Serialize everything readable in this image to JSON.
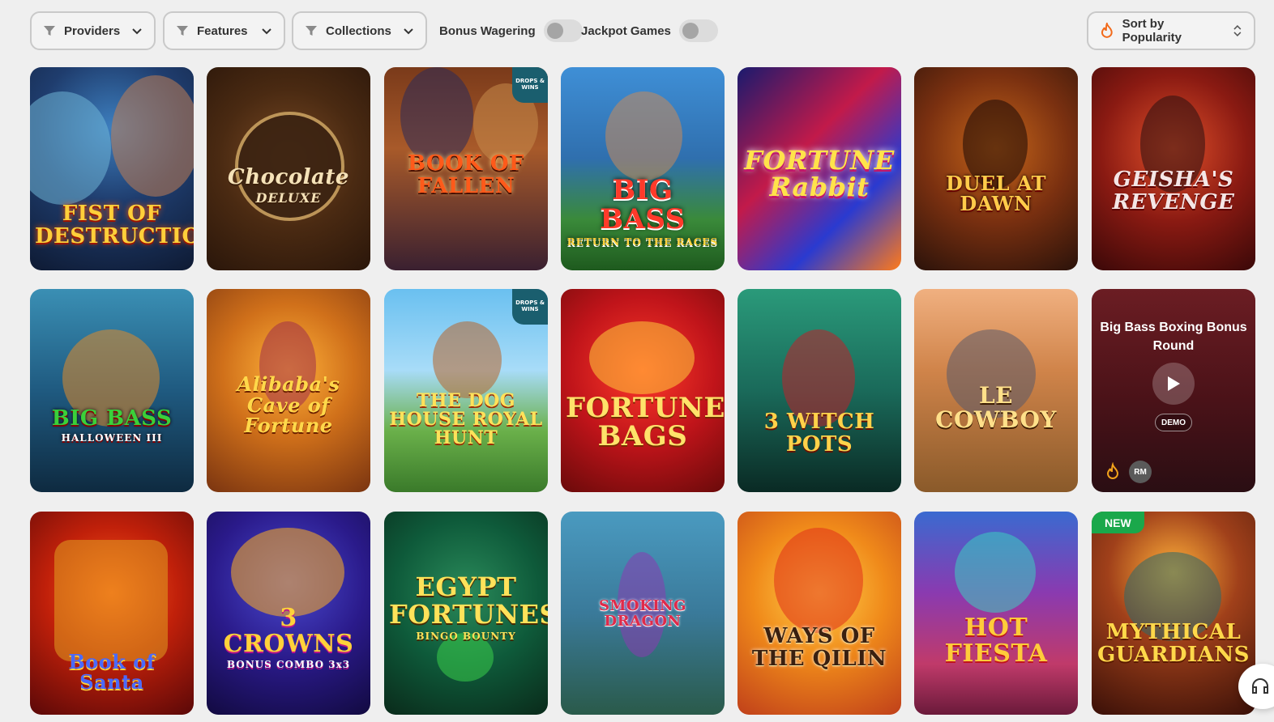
{
  "toolbar": {
    "providers_label": "Providers",
    "features_label": "Features",
    "collections_label": "Collections",
    "bonus_wagering_label": "Bonus Wagering",
    "bonus_wagering_on": false,
    "jackpot_games_label": "Jackpot Games",
    "jackpot_games_on": false,
    "sort_label": "Sort by Popularity",
    "sort_icon": "flame-icon"
  },
  "games": [
    {
      "title": "FIST OF DESTRUCTION",
      "sub": ""
    },
    {
      "title": "Chocolate",
      "sub": "DELUXE"
    },
    {
      "title": "BOOK OF FALLEN",
      "sub": "",
      "badge": "DROPS & WINS"
    },
    {
      "title": "BIG BASS",
      "sub": "RETURN TO THE RACES"
    },
    {
      "title": "FORTUNE Rabbit",
      "sub": ""
    },
    {
      "title": "DUEL AT DAWN",
      "sub": ""
    },
    {
      "title": "GEISHA'S REVENGE",
      "sub": ""
    },
    {
      "title": "BIG BASS",
      "sub": "HALLOWEEN III"
    },
    {
      "title": "Alibaba's Cave of Fortune",
      "sub": ""
    },
    {
      "title": "THE DOG HOUSE ROYAL HUNT",
      "sub": "",
      "badge": "DROPS & WINS"
    },
    {
      "title": "FORTUNE BAGS",
      "sub": ""
    },
    {
      "title": "3 WITCH POTS",
      "sub": ""
    },
    {
      "title": "LE COWBOY",
      "sub": ""
    },
    {
      "title": "Big Bass Boxing Bonus Round",
      "demo_label": "DEMO",
      "rm_label": "RM"
    },
    {
      "title": "Book of Santa",
      "sub": ""
    },
    {
      "title": "3 CROWNS",
      "sub": "BONUS COMBO 3x3"
    },
    {
      "title": "EGYPT FORTUNES",
      "sub": "BINGO BOUNTY"
    },
    {
      "title": "SMOKING DRAGON",
      "sub": ""
    },
    {
      "title": "WAYS OF THE QILIN",
      "sub": ""
    },
    {
      "title": "HOT FIESTA",
      "sub": ""
    },
    {
      "title": "MYTHICAL GUARDIANS",
      "sub": "",
      "new_label": "NEW"
    }
  ],
  "support_icon": "headset-icon"
}
